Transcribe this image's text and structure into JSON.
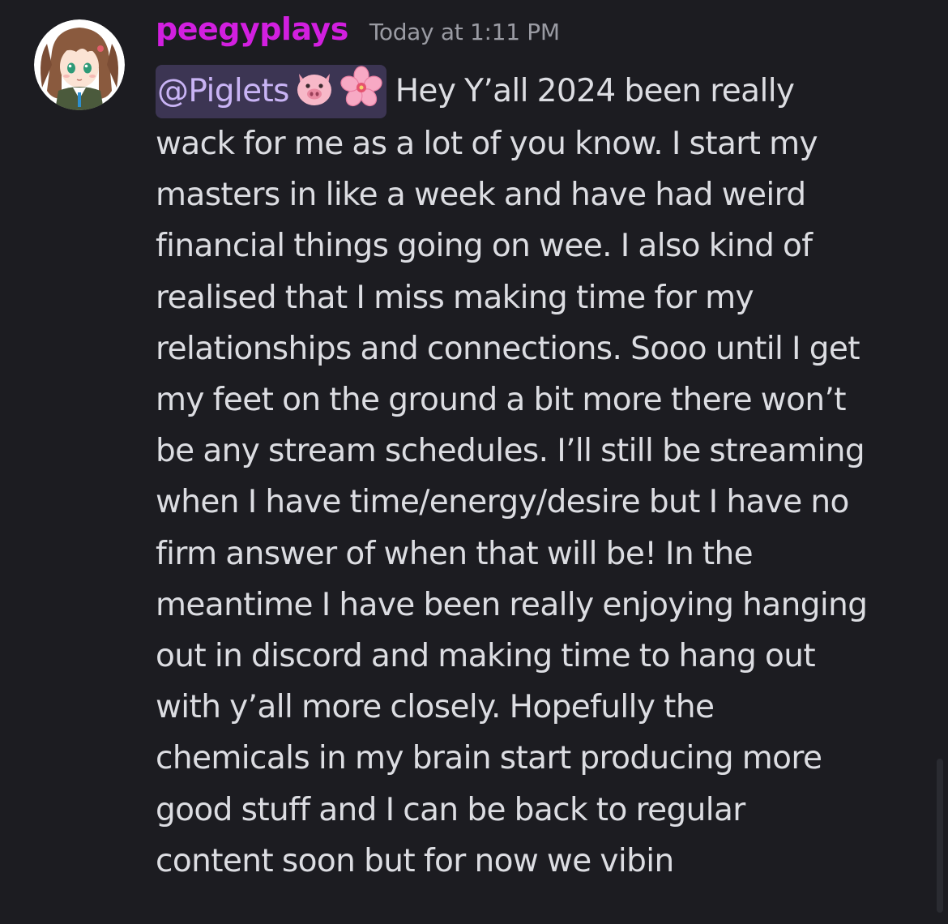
{
  "message": {
    "author": "peegyplays",
    "timestamp": "Today at 1:11 PM",
    "mention": "@Piglets",
    "emojis": [
      "pig-face-icon",
      "cherry-blossom-icon"
    ],
    "text": " Hey Y’all 2024 been really\nwack for me as a lot of you know. I start my\nmasters in like a week and have had weird\nfinancial things going on wee. I also kind of\nrealised that I miss making time for my\nrelationships and connections. Sooo until I get\nmy feet on the ground a bit more there won’t\nbe any stream schedules. I’ll still be streaming\nwhen I have time/energy/desire but I have no\nfirm answer of when that will be! In the\nmeantime I have been really enjoying hanging\nout in discord and making time to hang out\nwith y’all more closely. Hopefully the\nchemicals in my brain start producing more\ngood stuff and I can be back to regular\ncontent soon but for now we vibin"
  },
  "colors": {
    "background": "#1c1c21",
    "username": "#d21fe0",
    "timestamp": "#9a9ba3",
    "body_text": "#dcdde2",
    "mention_bg": "#3c3553",
    "mention_text": "#c9b4f5"
  }
}
